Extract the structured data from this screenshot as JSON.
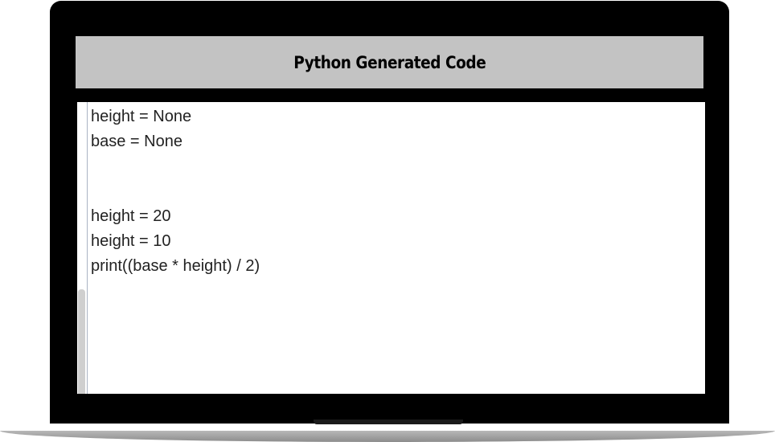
{
  "header": {
    "title": "Python Generated Code"
  },
  "code": {
    "lines": [
      "height = None",
      "base = None",
      "",
      "",
      "height = 20",
      "height = 10",
      "print((base * height) / 2)"
    ]
  },
  "colors": {
    "frame": "#000000",
    "header_background": "#c3c3c3",
    "panel_background": "#ffffff",
    "code_text": "#222222"
  }
}
